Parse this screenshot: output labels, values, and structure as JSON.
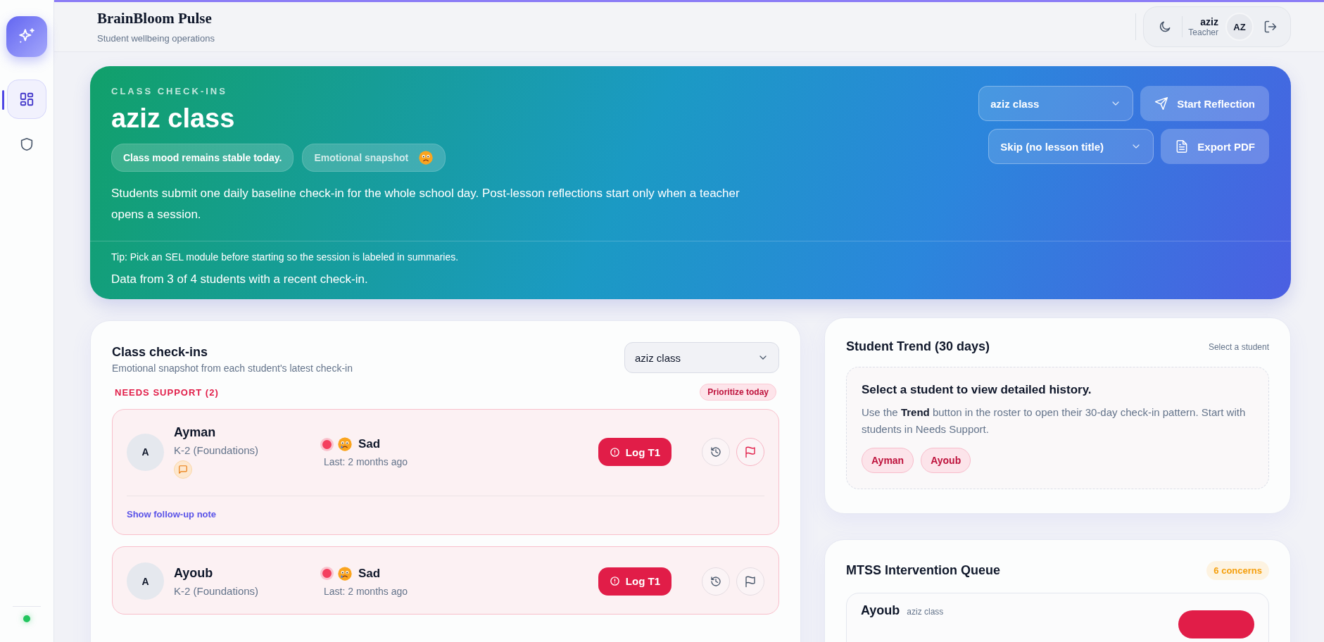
{
  "app": {
    "title": "BrainBloom Pulse",
    "subtitle": "Student wellbeing operations"
  },
  "sidebar": {
    "items": [
      {
        "kind": "dashboard",
        "selected": true
      },
      {
        "kind": "shield",
        "selected": false
      }
    ],
    "online": true
  },
  "user": {
    "name": "aziz",
    "role": "Teacher",
    "initials": "AZ"
  },
  "hero": {
    "eyebrow": "CLASS CHECK-INS",
    "title": "aziz class",
    "badges": [
      {
        "label": "Class mood remains stable today.",
        "kind": "status"
      },
      {
        "label": "Emotional snapshot",
        "kind": "emoji"
      }
    ],
    "description": "Students submit one daily baseline check-in for the whole school day. Post-lesson reflections start only when a teacher opens a session.",
    "tip": "Tip: Pick an SEL module before starting so the session is labeled in summaries.",
    "coverage": "Data from 3 of 4 students with a recent check-in.",
    "class_select": {
      "value": "aziz class"
    },
    "lesson_select": {
      "value": "Skip (no lesson title)"
    },
    "buttons": [
      {
        "label": "Start Reflection",
        "kind": "send"
      },
      {
        "label": "Export PDF",
        "kind": "document"
      }
    ]
  },
  "roster": {
    "title": "Class check-ins",
    "subtitle": "Emotional snapshot from each student's latest check-in",
    "class_select": {
      "value": "aziz class"
    },
    "group": {
      "label": "NEEDS SUPPORT (2)",
      "badge": "Prioritize today"
    },
    "students": [
      {
        "initial": "A",
        "name": "Ayman",
        "grade": "K-2 (Foundations)",
        "mood": "Sad",
        "color": "#f43f5e",
        "last": "Last: 2 months ago",
        "has_note": true,
        "flagged": true,
        "follow_up": "Show follow-up note",
        "action": "Log T1"
      },
      {
        "initial": "A",
        "name": "Ayoub",
        "grade": "K-2 (Foundations)",
        "mood": "Sad",
        "color": "#f43f5e",
        "last": "Last: 2 months ago",
        "has_note": false,
        "flagged": false,
        "action": "Log T1"
      }
    ]
  },
  "trend": {
    "title": "Student Trend (30 days)",
    "hint": "Select a student",
    "empty_title": "Select a student to view detailed history.",
    "empty_text": "Use the **Trend** button in the roster to open their 30-day check-in pattern. Start with students in Needs Support.",
    "chips": [
      "Ayman",
      "Ayoub"
    ]
  },
  "queue": {
    "title": "MTSS Intervention Queue",
    "badge": "6 concerns",
    "items": [
      {
        "name": "Ayoub",
        "class_name": "aziz class"
      }
    ]
  }
}
